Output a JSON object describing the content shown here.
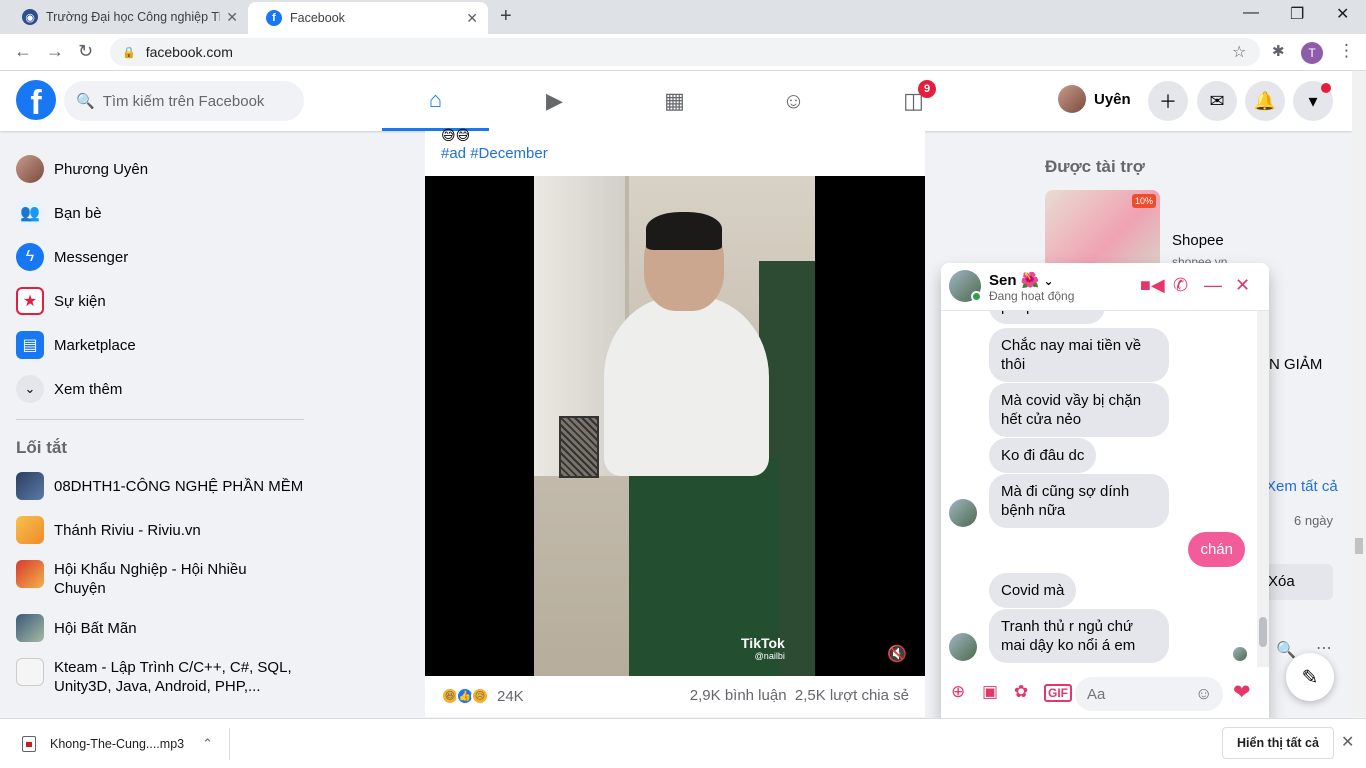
{
  "browser": {
    "tabs": [
      {
        "title": "Trường Đại học Công nghiệp Thự"
      },
      {
        "title": "Facebook"
      }
    ],
    "url": "facebook.com",
    "profile_initial": "T"
  },
  "fb_header": {
    "logo": "f",
    "search_placeholder": "Tìm kiếm trên Facebook",
    "nav": [
      "home-icon",
      "watch-icon",
      "marketplace-icon",
      "groups-icon",
      "gaming-icon"
    ],
    "notifications_badge": "9",
    "user_name": "Uyên"
  },
  "sidebar": {
    "items": [
      {
        "label": "Phương Uyên",
        "icon": "avatar"
      },
      {
        "label": "Bạn bè",
        "icon": "friends-icon"
      },
      {
        "label": "Messenger",
        "icon": "messenger-icon"
      },
      {
        "label": "Sự kiện",
        "icon": "calendar-icon"
      },
      {
        "label": "Marketplace",
        "icon": "shop-icon"
      },
      {
        "label": "Xem thêm",
        "icon": "chevron-down-icon"
      }
    ],
    "shortcuts_title": "Lối tắt",
    "shortcuts": [
      {
        "label": "08DHTH1-CÔNG NGHỆ PHẦN MỀM"
      },
      {
        "label": "Thánh Riviu - Riviu.vn"
      },
      {
        "label": "Hội Khẩu Nghiệp - Hội Nhiều Chuyện"
      },
      {
        "label": "Hội Bất Mãn"
      },
      {
        "label": "Kteam - Lập Trình C/C++, C#, SQL, Unity3D, Java, Android, PHP,..."
      }
    ]
  },
  "post": {
    "emojis": "😅😅",
    "hashtags": "#ad #December",
    "watermark": "TikTok",
    "watermark_handle": "@nailbi",
    "reaction_count": "24K",
    "comments": "2,9K bình luận",
    "shares": "2,5K lượt chia sẻ"
  },
  "right": {
    "sponsored_title": "Được tài trợ",
    "ad_name": "Shopee",
    "ad_url": "shopee.vn",
    "ad_badge": "10%",
    "partial_text_1": "N GIẢM",
    "partial_link": "Xem tất cả",
    "partial_time": "6 ngày",
    "partial_button": "Xóa"
  },
  "chat": {
    "name": "Sen 🌺",
    "status": "Đang hoạt động",
    "messages": [
      {
        "text": "phép rồi á em",
        "from": "them"
      },
      {
        "text": "Chắc nay mai tiền về thôi",
        "from": "them"
      },
      {
        "text": "Mà covid vầy bị chặn hết cửa nẻo",
        "from": "them"
      },
      {
        "text": "Ko đi đâu dc",
        "from": "them"
      },
      {
        "text": "Mà đi cũng sợ dính bệnh nữa",
        "from": "them"
      },
      {
        "text": "chán",
        "from": "me"
      },
      {
        "text": "Covid mà",
        "from": "them"
      },
      {
        "text": "Tranh thủ r ngủ chứ mai dậy ko nổi á em",
        "from": "them"
      }
    ],
    "input_placeholder": "Aa"
  },
  "downloads": {
    "file": "Khong-The-Cung....mp3",
    "show_all": "Hiển thị tất cả"
  },
  "colors": {
    "fb_blue": "#1877f2",
    "chat_accent": "#e5366a",
    "my_bubble": "#f25d99"
  }
}
